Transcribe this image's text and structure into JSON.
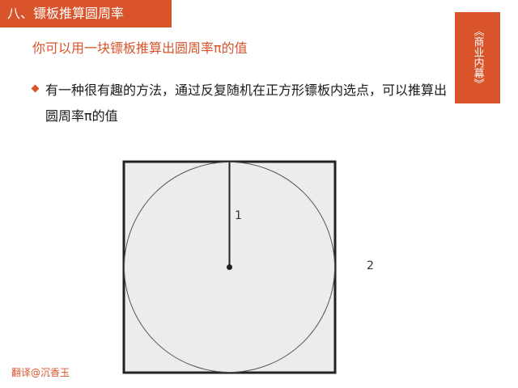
{
  "header": {
    "title": "八、镖板推算圆周率"
  },
  "side_tab": {
    "label": "《商业内幕》"
  },
  "subtitle": "你可以用一块镖板推算出圆周率π的值",
  "bullet": {
    "icon": "diamond-bullet-icon",
    "text": "有一种很有趣的方法，通过反复随机在正方形镖板内选点，可以推算出圆周率π的值"
  },
  "diagram": {
    "radius_label": "1",
    "side_label": "2"
  },
  "watermark": "翻译@沉香玉",
  "colors": {
    "accent": "#d9532b",
    "board_fill": "#ececec",
    "line": "#222222"
  }
}
